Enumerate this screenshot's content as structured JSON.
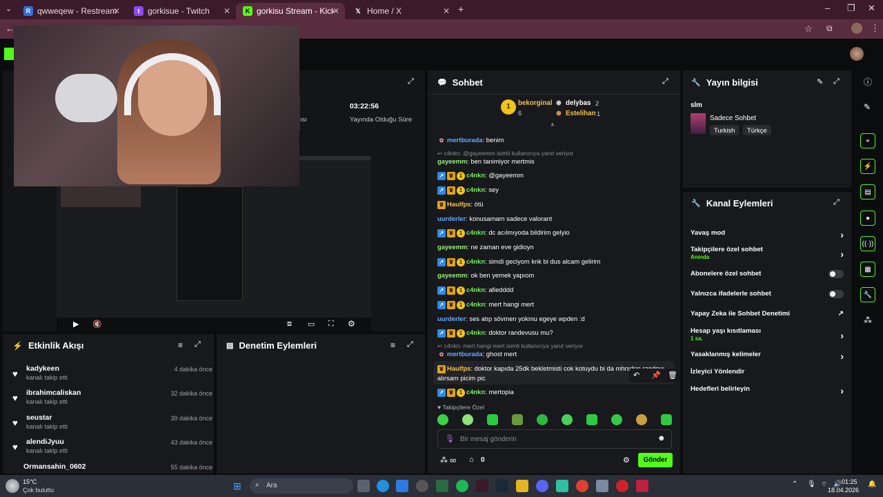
{
  "browser": {
    "tabs": [
      {
        "label": "qwweqew - Restream",
        "icon": "restream-icon"
      },
      {
        "label": "gorkisue - Twitch",
        "icon": "twitch-icon"
      },
      {
        "label": "gorkisu Stream - Kick Dashboar",
        "icon": "kick-icon"
      },
      {
        "label": "Home / X",
        "icon": "x-icon"
      }
    ],
    "new_tab": "+"
  },
  "stream_stats": {
    "duration_value": "03:22:56",
    "duration_label": "Yayında Olduğu Süre",
    "partial_label": "ısı"
  },
  "activity": {
    "title": "Etkinlik Akışı",
    "items": [
      {
        "name": "kadykeen",
        "action": "kanalı takip etti",
        "time": "4 dakika önce"
      },
      {
        "name": "ibrahimcaliskan",
        "action": "kanalı takip etti",
        "time": "32 dakika önce"
      },
      {
        "name": "seustar",
        "action": "kanalı takip etti",
        "time": "39 dakika önce"
      },
      {
        "name": "alendiJyuu",
        "action": "kanalı takip etti",
        "time": "43 dakika önce"
      },
      {
        "name": "Ormansahin_0602",
        "action": "",
        "time": "55 dakika önce"
      }
    ]
  },
  "moderation": {
    "title": "Denetim Eylemleri"
  },
  "chat": {
    "title": "Sohbet",
    "top": [
      {
        "name": "bekorginal",
        "count": "6"
      },
      {
        "name": "delybas",
        "count": "2"
      },
      {
        "name": "Estelihan",
        "count": "1"
      }
    ],
    "messages": [
      {
        "user": "mertburada",
        "text": ": benim"
      },
      {
        "reply": "c4nkn: @gayeemm isimli kullanıcıya yanıt veriyor"
      },
      {
        "user": "gayeemm",
        "text": ": ben tanimiyor mertmis"
      },
      {
        "user": "c4nkn",
        "text": ": @gayeemm"
      },
      {
        "user": "c4nkn",
        "text": ": sey"
      },
      {
        "user": "Haulfps",
        "text": ": ötü"
      },
      {
        "user": "uurderler",
        "text": ": konusamam sadece valorant"
      },
      {
        "user": "c4nkn",
        "text": ": dc acılmıyoda bildirim gelyio"
      },
      {
        "user": "gayeemm",
        "text": ": ne zaman eve gidioyn"
      },
      {
        "user": "c4nkn",
        "text": ": simdi geciyom knk bi dus alcam gelirim"
      },
      {
        "user": "gayeemm",
        "text": ": ok ben yemek yapıom"
      },
      {
        "user": "c4nkn",
        "text": ": afiedddd"
      },
      {
        "user": "c4nkn",
        "text": ": mert hangi mert"
      },
      {
        "user": "uurderler",
        "text": ": ses atıp sövmen yokmu egeye wpden :d"
      },
      {
        "user": "c4nkn",
        "text": ": doktor randevusu mu?"
      },
      {
        "reply": "c4nkn: mert hangi mert isimli kullanıcıya yanıt veriyor"
      },
      {
        "user": "mertburada",
        "text": ": ghost mert"
      },
      {
        "user": "Haulfps",
        "text": ": doktor kapıda 25dk bekletmisti cok kotuydu bi da mhrsden randevu"
      },
      {
        "text": "alırsam picim pic"
      },
      {
        "user": "c4nkn",
        "text": ": mertopia"
      }
    ],
    "followers_only_label": "Takipçilere Özel",
    "input_placeholder": "Bir mesaj gönderin",
    "points_value": "0",
    "send_label": "Gönder"
  },
  "stream_info": {
    "title": "Yayın bilgisi",
    "stream_title": "slm",
    "category": "Sadece Sohbet",
    "tags": [
      "Turkish",
      "Türkçe"
    ]
  },
  "channel_actions": {
    "title": "Kanal Eylemleri",
    "items": [
      {
        "label": "Yavaş mod"
      },
      {
        "label": "Takipçilere özel sohbet",
        "sub": "Anında"
      },
      {
        "label": "Abonelere özel sohbet"
      },
      {
        "label": "Yalnızca ifadelerle sohbet"
      },
      {
        "label": "Yapay Zeka ile Sohbet Denetimi"
      },
      {
        "label": "Hesap yaşı kısıtlaması",
        "sub": "1 sa."
      },
      {
        "label": "Yasaklanmış kelimeler"
      },
      {
        "label": "İzleyici Yönlendir"
      },
      {
        "label": "Hedefleri belirleyin"
      }
    ]
  },
  "taskbar": {
    "weather_temp": "15°C",
    "weather_desc": "Çok bulutlu",
    "search": "Ara",
    "time": "01:25",
    "date": "18.04.2026"
  },
  "colors": {
    "kick_green": "#53fc18",
    "panel": "#18191c",
    "tabbar": "#3b1b2a"
  }
}
